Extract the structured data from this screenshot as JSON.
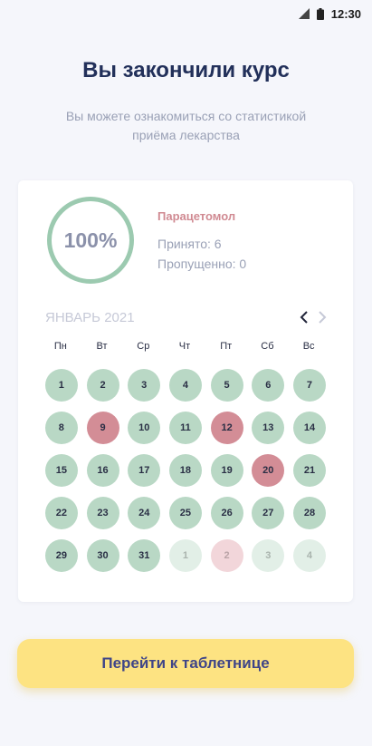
{
  "status_bar": {
    "time": "12:30",
    "icons": [
      "signal-icon",
      "battery-icon"
    ]
  },
  "header": {
    "title": "Вы закончили курс",
    "subtitle_line1": "Вы можете ознакомиться со статистикой",
    "subtitle_line2": "приёма лекарства"
  },
  "stats": {
    "progress": "100%",
    "drug_name": "Парацетомол",
    "taken": "Принято: 6",
    "missed": "Пропущенно: 0"
  },
  "calendar": {
    "month": "ЯНВАРЬ 2021",
    "weekdays": [
      "Пн",
      "Вт",
      "Ср",
      "Чт",
      "Пт",
      "Сб",
      "Вс"
    ],
    "days": [
      {
        "label": "1",
        "state": "taken-day"
      },
      {
        "label": "2",
        "state": "taken-day"
      },
      {
        "label": "3",
        "state": "taken-day"
      },
      {
        "label": "4",
        "state": "taken-day"
      },
      {
        "label": "5",
        "state": "taken-day"
      },
      {
        "label": "6",
        "state": "taken-day"
      },
      {
        "label": "7",
        "state": "taken-day"
      },
      {
        "label": "8",
        "state": "taken-day"
      },
      {
        "label": "9",
        "state": "missed-day"
      },
      {
        "label": "10",
        "state": "taken-day"
      },
      {
        "label": "11",
        "state": "taken-day"
      },
      {
        "label": "12",
        "state": "missed-day"
      },
      {
        "label": "13",
        "state": "taken-day"
      },
      {
        "label": "14",
        "state": "taken-day"
      },
      {
        "label": "15",
        "state": "taken-day"
      },
      {
        "label": "16",
        "state": "taken-day"
      },
      {
        "label": "17",
        "state": "taken-day"
      },
      {
        "label": "18",
        "state": "taken-day"
      },
      {
        "label": "19",
        "state": "taken-day"
      },
      {
        "label": "20",
        "state": "missed-day"
      },
      {
        "label": "21",
        "state": "taken-day"
      },
      {
        "label": "22",
        "state": "taken-day"
      },
      {
        "label": "23",
        "state": "taken-day"
      },
      {
        "label": "24",
        "state": "taken-day"
      },
      {
        "label": "25",
        "state": "taken-day"
      },
      {
        "label": "26",
        "state": "taken-day"
      },
      {
        "label": "27",
        "state": "taken-day"
      },
      {
        "label": "28",
        "state": "taken-day"
      },
      {
        "label": "29",
        "state": "taken-day"
      },
      {
        "label": "30",
        "state": "taken-day"
      },
      {
        "label": "31",
        "state": "taken-day"
      },
      {
        "label": "1",
        "state": "next-taken"
      },
      {
        "label": "2",
        "state": "next-missed"
      },
      {
        "label": "3",
        "state": "next-taken"
      },
      {
        "label": "4",
        "state": "next-taken"
      }
    ]
  },
  "cta": {
    "label": "Перейти к таблетнице"
  },
  "colors": {
    "background": "#f5f6fb",
    "title": "#22305a",
    "taken": "#b9d8c5",
    "missed": "#d38d96",
    "cta": "#fde382",
    "cta_text": "#3f4588"
  }
}
